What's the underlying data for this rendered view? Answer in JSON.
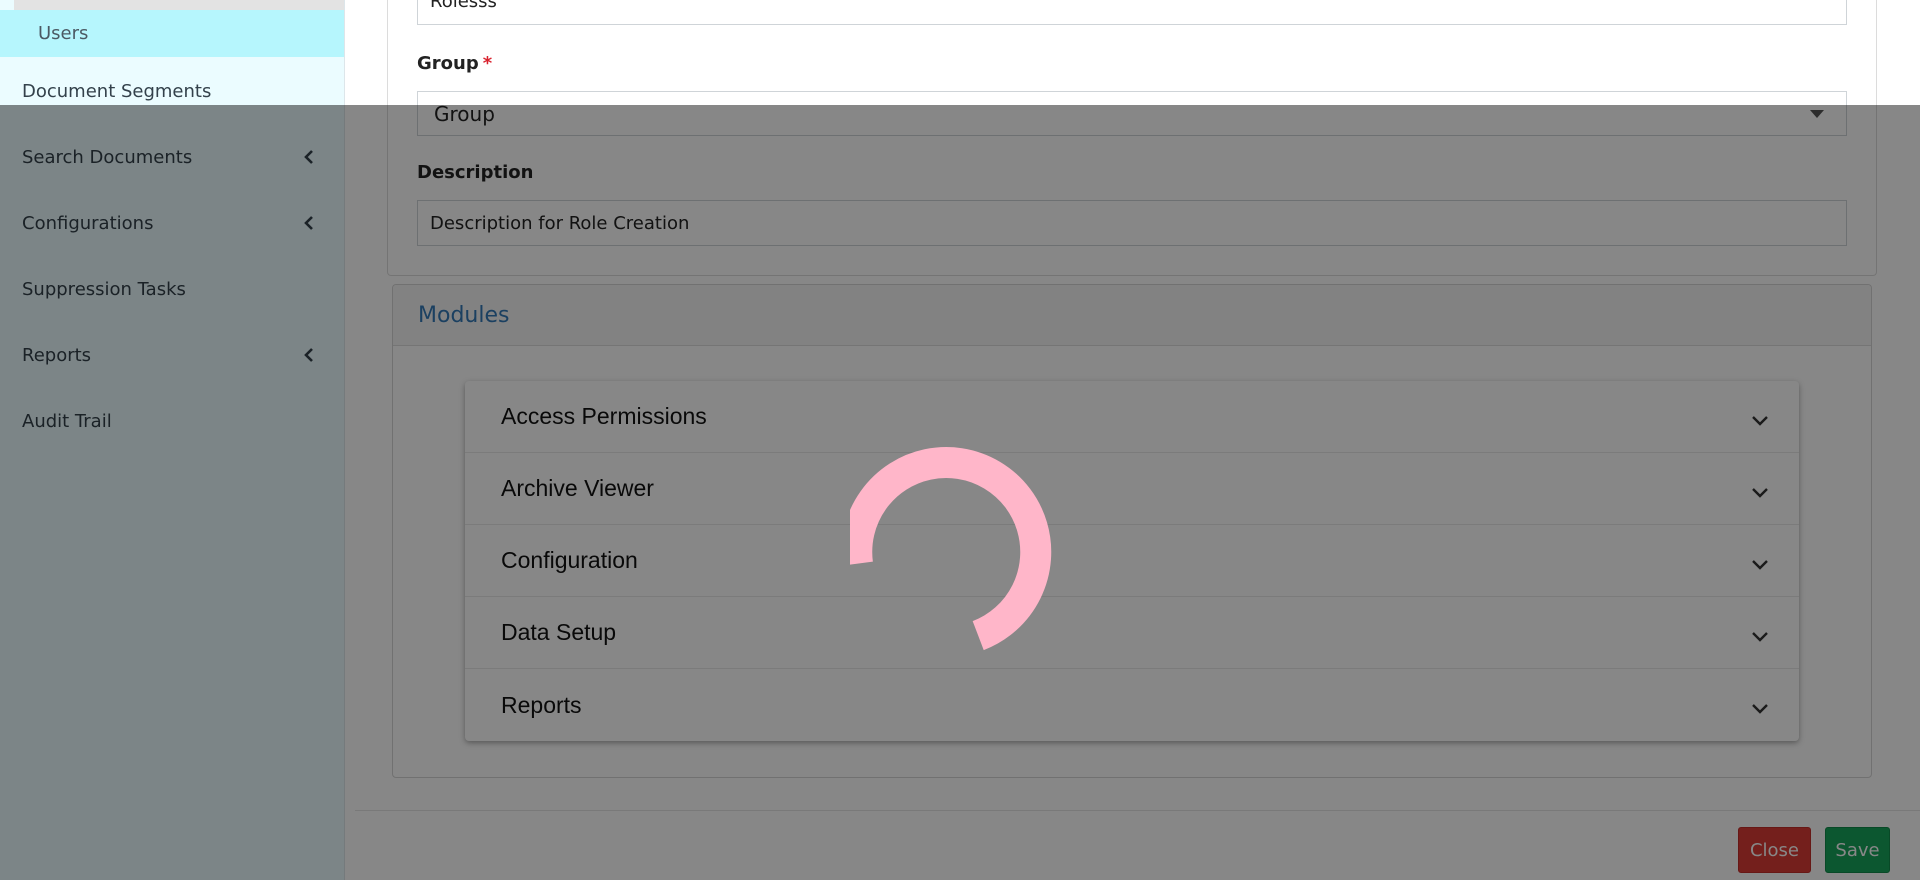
{
  "sidebar": {
    "items": [
      {
        "label": "Users",
        "has_chevron": false,
        "active_sub": true
      },
      {
        "label": "Document Segments",
        "has_chevron": false
      },
      {
        "label": "Search Documents",
        "has_chevron": true
      },
      {
        "label": "Configurations",
        "has_chevron": true
      },
      {
        "label": "Suppression Tasks",
        "has_chevron": false
      },
      {
        "label": "Reports",
        "has_chevron": true
      },
      {
        "label": "Audit Trail",
        "has_chevron": false
      }
    ]
  },
  "form": {
    "role_name_value": "Rolesss",
    "group": {
      "label": "Group",
      "required_mark": "*",
      "selected_value": "Group"
    },
    "description": {
      "label": "Description",
      "value": "Description for Role Creation"
    }
  },
  "modules": {
    "title": "Modules",
    "items": [
      "Access Permissions",
      "Archive Viewer",
      "Configuration",
      "Data Setup",
      "Reports"
    ]
  },
  "footer": {
    "close_label": "Close",
    "save_label": "Save"
  },
  "colors": {
    "sidebar_bg": "#ebfcff",
    "active_item_bg": "#b6f6fd",
    "link_blue": "#337ab7",
    "close_red": "#dc3b36",
    "save_green": "#18a45b",
    "spinner_pink": "#ffb6c9",
    "required_red": "#d9232f"
  },
  "icons": {
    "sidebar_chevron": "chevron-left-icon",
    "accordion_chevron": "chevron-down-icon",
    "select_caret": "caret-down-icon"
  }
}
